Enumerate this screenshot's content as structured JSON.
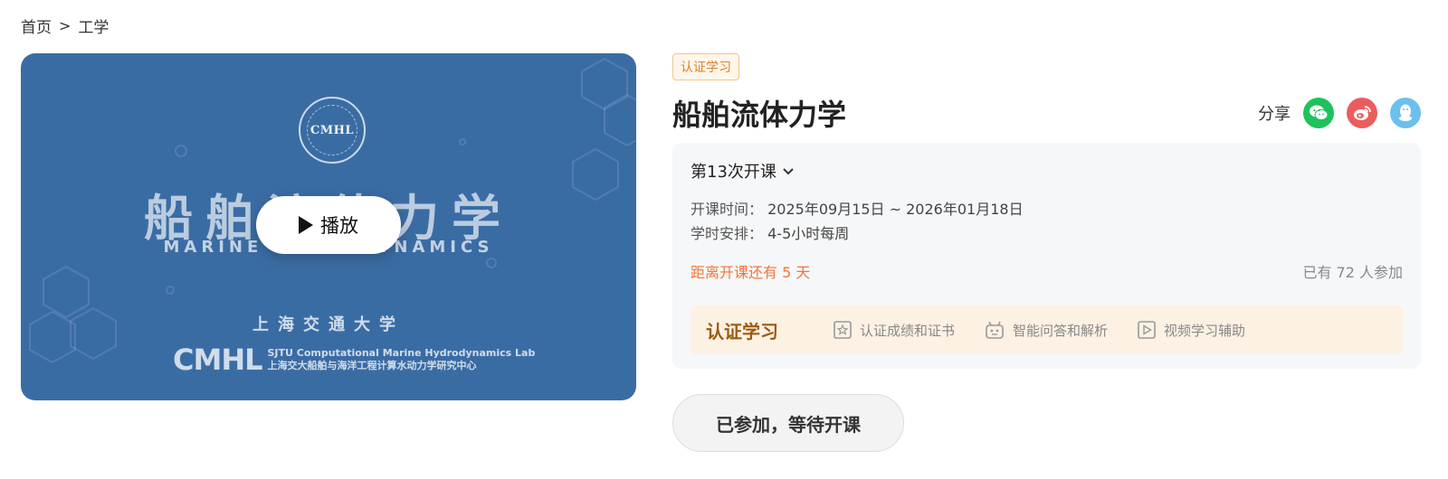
{
  "breadcrumb": {
    "home": "首页",
    "separator": ">",
    "current": "工学"
  },
  "cover": {
    "seal_text": "CMHL",
    "title": "船舶流体力学",
    "subtitle_en": "MARINE HYDRODYNAMICS",
    "university": "上海交通大学",
    "lab_abbr": "CMHL",
    "lab_name_en": "SJTU Computational Marine Hydrodynamics Lab",
    "lab_name_cn": "上海交大船舶与海洋工程计算水动力学研究中心",
    "play_label": "播放",
    "background_color": "#3a6ca4"
  },
  "course": {
    "tag": "认证学习",
    "title": "船舶流体力学",
    "share_label": "分享",
    "share_icons": [
      "wechat-icon",
      "weibo-icon",
      "qq-icon"
    ],
    "session": "第13次开课",
    "time_label": "开课时间：",
    "time_value": "2025年09月15日 ~ 2026年01月18日",
    "hours_label": "学时安排：",
    "hours_value": "4-5小时每周",
    "countdown": "距离开课还有 5 天",
    "joined": "已有 72 人参加",
    "cert": {
      "title": "认证学习",
      "features": [
        {
          "icon": "certificate-icon",
          "label": "认证成绩和证书"
        },
        {
          "icon": "robot-icon",
          "label": "智能问答和解析"
        },
        {
          "icon": "video-play-icon",
          "label": "视频学习辅助"
        }
      ]
    },
    "join_button": "已参加，等待开课"
  },
  "colors": {
    "accent_orange": "#f0763a",
    "cert_brown": "#9a5c10",
    "tag_orange": "#d9822b"
  }
}
